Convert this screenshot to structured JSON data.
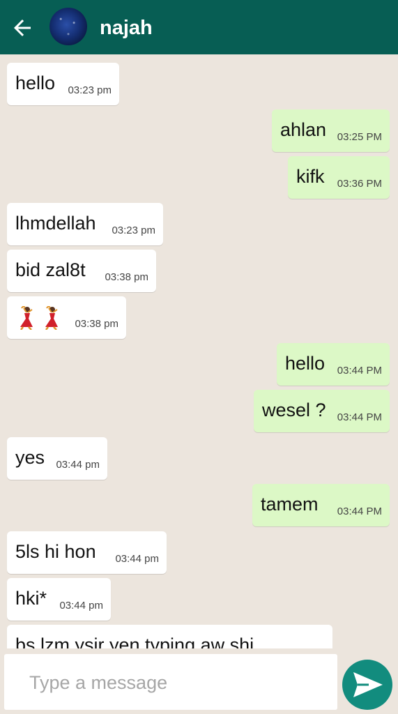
{
  "header": {
    "back_icon": "arrow-left-icon",
    "contact_name": "najah"
  },
  "messages": [
    {
      "dir": "in",
      "text": "hello",
      "time": "03:23 pm"
    },
    {
      "dir": "out",
      "text": "ahlan",
      "time": "03:25 PM"
    },
    {
      "dir": "out",
      "text": "kifk",
      "time": "03:36 PM"
    },
    {
      "dir": "in",
      "text": "lhmdellah",
      "time": "03:23 pm"
    },
    {
      "dir": "in",
      "text": "bid zal8t",
      "time": "03:38 pm"
    },
    {
      "dir": "in",
      "text": "",
      "emoji": [
        "dancer-icon",
        "dancer-icon"
      ],
      "time": "03:38 pm"
    },
    {
      "dir": "out",
      "text": "hello",
      "time": "03:44 PM"
    },
    {
      "dir": "out",
      "text": "wesel ?",
      "time": "03:44 PM"
    },
    {
      "dir": "in",
      "text": "yes",
      "time": "03:44 pm"
    },
    {
      "dir": "out",
      "text": "tamem",
      "time": "03:44 PM"
    },
    {
      "dir": "in",
      "text": "5ls hi hon",
      "time": "03:44 pm"
    },
    {
      "dir": "in",
      "text": "hki*",
      "time": "03:44 pm"
    },
    {
      "dir": "in",
      "text": "bs lzm ysir yen typing aw shi",
      "time": ""
    }
  ],
  "composer": {
    "placeholder": "Type a message",
    "value": "",
    "send_icon": "send-icon"
  },
  "colors": {
    "header": "#075e54",
    "background": "#ece5dd",
    "incoming_bubble": "#ffffff",
    "outgoing_bubble": "#dcf8c6",
    "send_button": "#128c7e"
  }
}
